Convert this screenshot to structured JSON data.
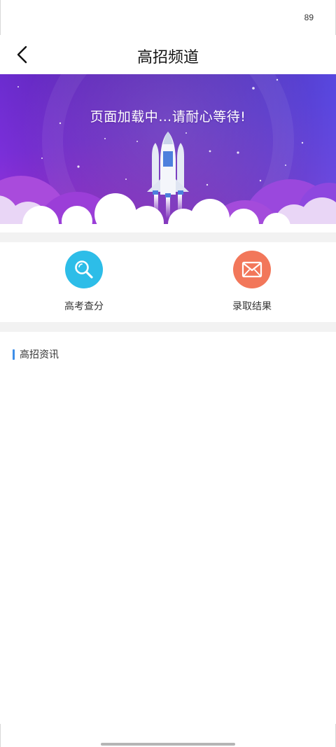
{
  "status_bar": {
    "battery": "89"
  },
  "nav": {
    "title": "高招频道"
  },
  "banner": {
    "loading_text": "页面加载中…请耐心等待!"
  },
  "quick_entries": [
    {
      "label": "高考查分",
      "icon": "search-icon",
      "color": "#2dbde8"
    },
    {
      "label": "录取结果",
      "icon": "mail-icon",
      "color": "#f2775a"
    }
  ],
  "news": {
    "section_title": "高招资讯",
    "accent_color": "#3e8ee8"
  },
  "colors": {
    "banner_top": "#6a2fd8",
    "banner_mid": "#8a2fd6",
    "banner_bottom": "#c03ad8",
    "background_gap": "#f2f2f2"
  }
}
